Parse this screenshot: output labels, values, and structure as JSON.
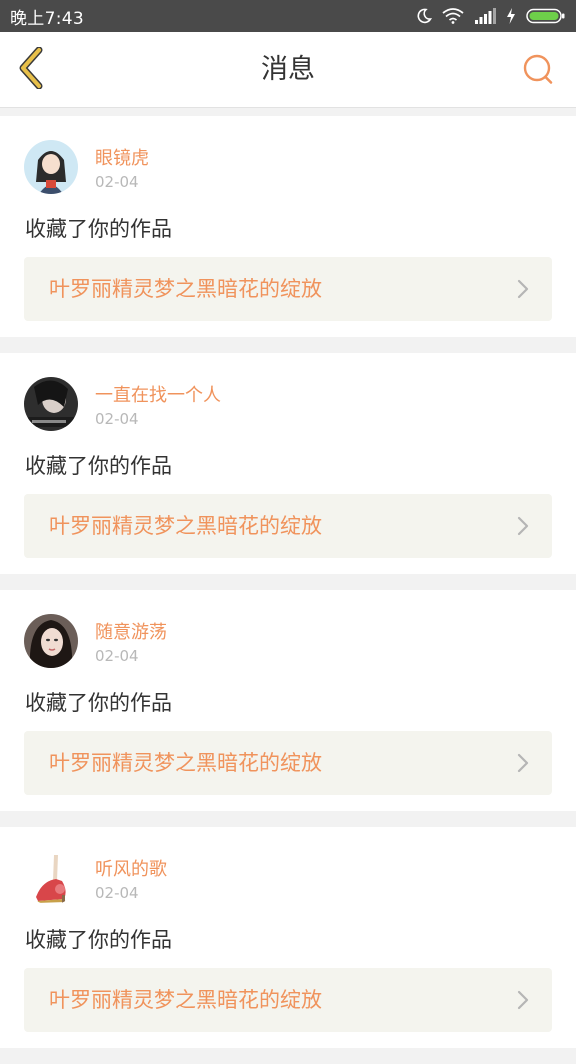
{
  "status_bar": {
    "time": "晚上7:43",
    "icons": [
      "moon-icon",
      "wifi-icon",
      "signal-icon",
      "charging-icon",
      "battery-icon"
    ]
  },
  "header": {
    "title": "消息",
    "back_icon": "chevron-left-icon",
    "search_icon": "search-icon"
  },
  "colors": {
    "accent": "#f0935c",
    "back_icon": "#e8c04a",
    "link_background": "#f4f4ee",
    "status_bar": "#4a4a4a"
  },
  "messages": [
    {
      "user": "眼镜虎",
      "date": "02-04",
      "action": "收藏了你的作品",
      "work": "叶罗丽精灵梦之黑暗花的绽放"
    },
    {
      "user": "一直在找一个人",
      "date": "02-04",
      "action": "收藏了你的作品",
      "work": "叶罗丽精灵梦之黑暗花的绽放"
    },
    {
      "user": "随意游荡",
      "date": "02-04",
      "action": "收藏了你的作品",
      "work": "叶罗丽精灵梦之黑暗花的绽放"
    },
    {
      "user": "听风的歌",
      "date": "02-04",
      "action": "收藏了你的作品",
      "work": "叶罗丽精灵梦之黑暗花的绽放"
    }
  ]
}
